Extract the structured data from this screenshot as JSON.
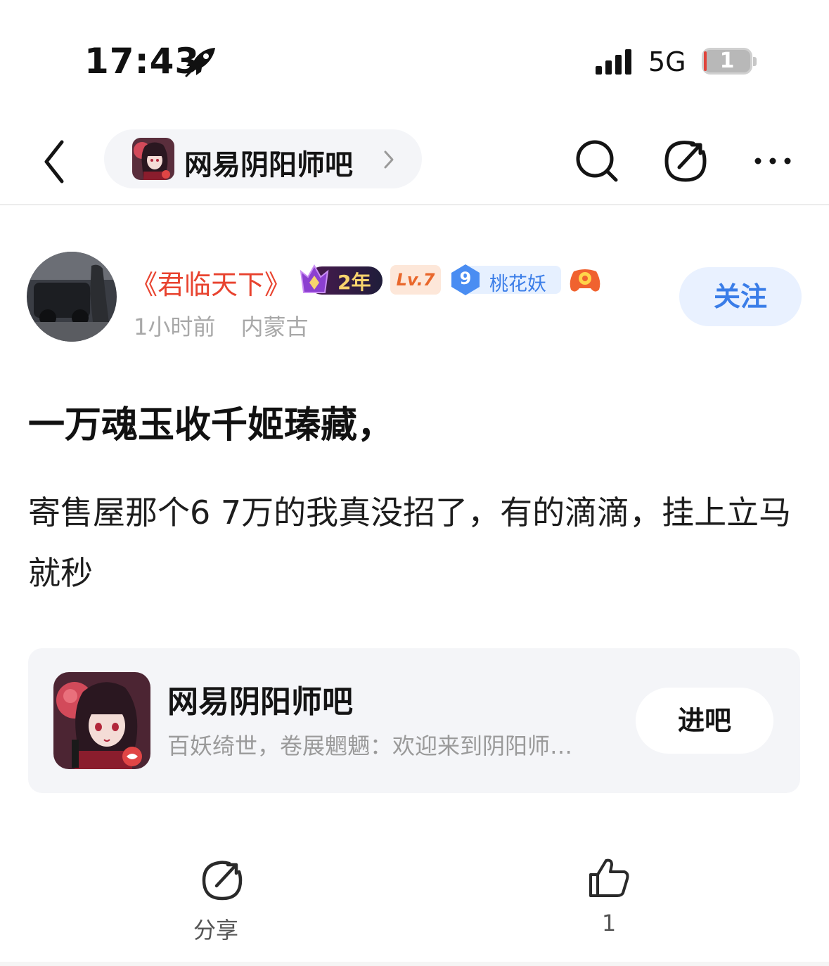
{
  "status_bar": {
    "time": "17:43",
    "network": "5G",
    "battery_level": "1"
  },
  "nav": {
    "forum_name": "网易阴阳师吧"
  },
  "author": {
    "name": "《君临天下》",
    "badge_year": "2年",
    "badge_level": "Lv.7",
    "badge_rank_num": "9",
    "badge_rank_title": "桃花妖",
    "time_ago": "1小时前",
    "location": "内蒙古",
    "follow_label": "关注"
  },
  "post": {
    "title": "一万魂玉收千姬瑧藏，",
    "body": "寄售屋那个6 7万的我真没招了，有的滴滴，挂上立马就秒"
  },
  "forum_card": {
    "name": "网易阴阳师吧",
    "description": "百妖绮世，卷展魍魉：欢迎来到阴阳师…",
    "enter_label": "进吧"
  },
  "bottom_bar": {
    "share_label": "分享",
    "like_count": "1"
  },
  "colors": {
    "author_name": "#e8432f",
    "accent_blue": "#3a7de8",
    "card_bg": "#f4f5f8"
  }
}
